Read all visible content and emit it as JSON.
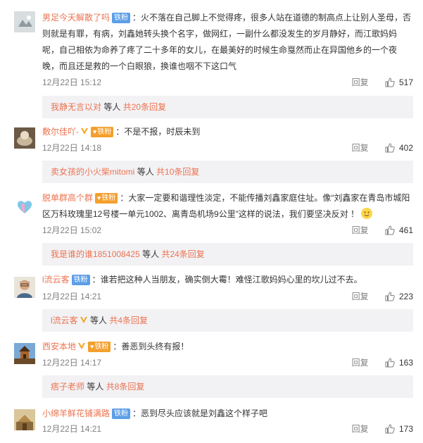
{
  "comments": [
    {
      "user": "男足今天解散了吗",
      "badge": "铁粉",
      "text": "：火不落在自己脚上不觉得疼，很多人站在道德的制高点上让别人圣母，否则就是有罪，有病，刘鑫她转头换个名字，做网红，一副什么都没发生的岁月静好，而江歌妈妈呢，自己相依为命养了疼了二十多年的女儿，在最美好的时候生命戛然而止在异国他乡的一个夜晚，而且还是救的一个白眼狼，换谁也咽不下这口气",
      "time": "12月22日 15:12",
      "reply": "回复",
      "likes": "517",
      "sub_user": "我静无言以对",
      "sub_mid": "等人",
      "sub_more": "共20条回复"
    },
    {
      "user": "敷尔佳吖-",
      "badge": "铁粉",
      "text": "：不是不报，时辰未到",
      "time": "12月22日 14:18",
      "reply": "回复",
      "likes": "402",
      "sub_user": "卖女孩的小火柴mitomi",
      "sub_mid": "等人",
      "sub_more": "共10条回复"
    },
    {
      "user": "脱单群高个群",
      "badge": "铁粉",
      "text": "：大家一定要和谐理性淡定，不能传播刘鑫家庭住址。像“刘鑫家在青岛市城阳区万科玫瑰里12号楼一单元1002、离青岛机场9公里”这样的说法，我们要坚决反对 ！",
      "time": "12月22日 15:02",
      "reply": "回复",
      "likes": "461",
      "sub_user": "我是谁的谁1851008425",
      "sub_mid": "等人",
      "sub_more": "共24条回复"
    },
    {
      "user": "l流云客",
      "badge": "铁粉",
      "text": "：谁若把这种人当朋友，确实倒大霉！难怪江歌妈妈心里的坎儿过不去。",
      "time": "12月22日 14:21",
      "reply": "回复",
      "likes": "223",
      "sub_user": "l流云客",
      "sub_mid": "等人",
      "sub_more": "共4条回复"
    },
    {
      "user": "西安本地",
      "badge": "铁粉",
      "text": "：善恶到头终有报！",
      "time": "12月22日 14:17",
      "reply": "回复",
      "likes": "163",
      "sub_user": "痞子老师",
      "sub_mid": "等人",
      "sub_more": "共8条回复"
    },
    {
      "user": "小绵羊鲜花铺满路",
      "badge": "铁粉",
      "text": "：恶到尽头应该就是刘鑫这个样子吧",
      "time": "12月22日 14:21",
      "reply": "回复",
      "likes": "173"
    }
  ],
  "colors": {
    "link": "#eb7350",
    "sub_bg": "#f2f2f5",
    "badge_blue": "#5c9ee8",
    "badge_orange": "#f49f2d"
  }
}
